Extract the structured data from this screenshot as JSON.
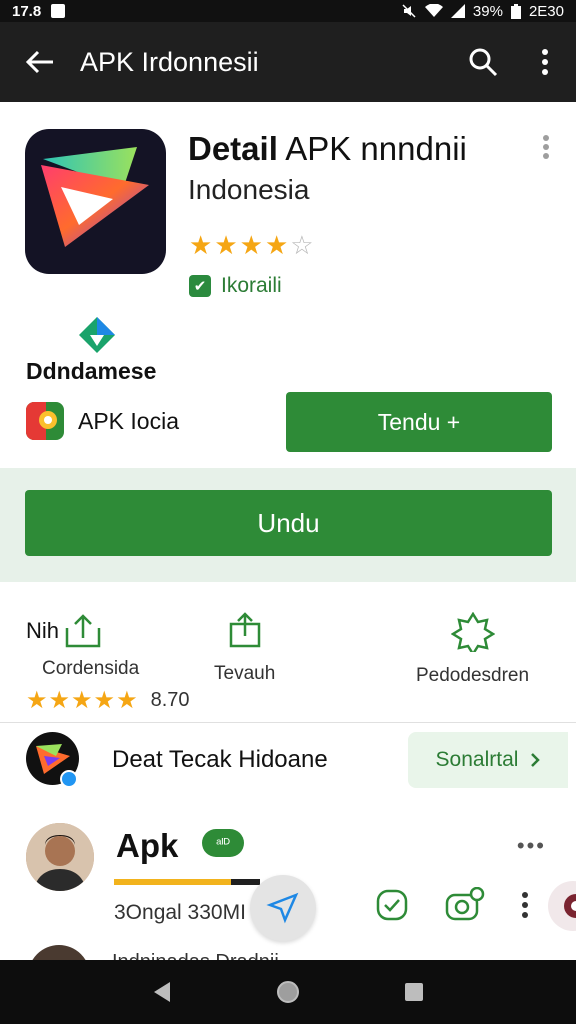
{
  "status_bar": {
    "time": "17.8",
    "battery": "39%",
    "clock": "2E30"
  },
  "app_bar": {
    "title": "APK Irdonnesii"
  },
  "app": {
    "title_bold": "Detail",
    "title_rest": " APK nnndnii",
    "subtitle": "Indonesia",
    "rating_stars": 4,
    "verified_label": "Ikoraili",
    "developer": "Ddndamese",
    "publisher": "APK Iocia",
    "secondary_button": "Tendu +",
    "install_button": "Undu"
  },
  "stats": [
    {
      "head": "Nih",
      "label": "Cordensida"
    },
    {
      "head": "",
      "label": "Tevauh"
    },
    {
      "head": "",
      "label": "Pedodesdren"
    }
  ],
  "rating_row": {
    "stars": 5,
    "value": "8.70"
  },
  "list": {
    "row1_text": "Deat Tecak Hidoane",
    "row1_chip": "Sonalrtal",
    "row2_title": "Apk",
    "row2_pill": "ᵃᴵᴰ",
    "row2_sub": "3Ongal 330MI",
    "row2_progress": 0.8,
    "row3_text": "Indninadas Dradnii"
  },
  "colors": {
    "accent": "#2e8b37",
    "star": "#f5a614",
    "appbar": "#1f1f1f"
  }
}
